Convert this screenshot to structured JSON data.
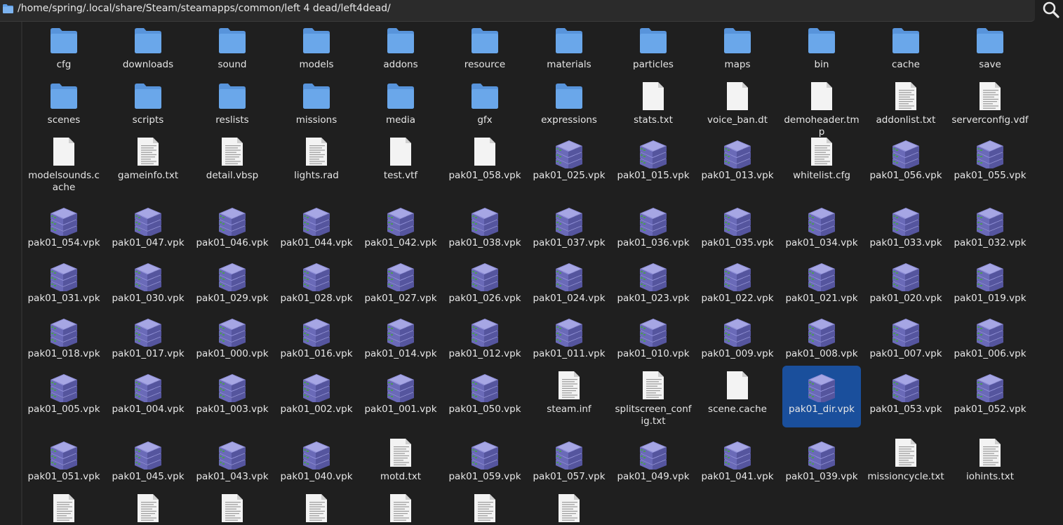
{
  "path_bar": {
    "path": "/home/spring/.local/share/Steam/steamapps/common/left 4 dead/left4dead/"
  },
  "colors": {
    "background": "#1f1f1f",
    "folder": "#6aa7ea",
    "selection": "#1a4f9c",
    "package": "#8f8fd8"
  },
  "files": [
    {
      "name": "cfg",
      "type": "folder"
    },
    {
      "name": "downloads",
      "type": "folder"
    },
    {
      "name": "sound",
      "type": "folder"
    },
    {
      "name": "models",
      "type": "folder"
    },
    {
      "name": "addons",
      "type": "folder"
    },
    {
      "name": "resource",
      "type": "folder"
    },
    {
      "name": "materials",
      "type": "folder"
    },
    {
      "name": "particles",
      "type": "folder"
    },
    {
      "name": "maps",
      "type": "folder"
    },
    {
      "name": "bin",
      "type": "folder"
    },
    {
      "name": "cache",
      "type": "folder"
    },
    {
      "name": "save",
      "type": "folder"
    },
    {
      "name": "scenes",
      "type": "folder"
    },
    {
      "name": "scripts",
      "type": "folder"
    },
    {
      "name": "reslists",
      "type": "folder"
    },
    {
      "name": "missions",
      "type": "folder"
    },
    {
      "name": "media",
      "type": "folder"
    },
    {
      "name": "gfx",
      "type": "folder"
    },
    {
      "name": "expressions",
      "type": "folder"
    },
    {
      "name": "stats.txt",
      "type": "blank"
    },
    {
      "name": "voice_ban.dt",
      "type": "blank"
    },
    {
      "name": "demoheader.tmp",
      "type": "blank"
    },
    {
      "name": "addonlist.txt",
      "type": "text"
    },
    {
      "name": "serverconfig.vdf",
      "type": "text"
    },
    {
      "name": "modelsounds.cache",
      "type": "blank"
    },
    {
      "name": "gameinfo.txt",
      "type": "text"
    },
    {
      "name": "detail.vbsp",
      "type": "text"
    },
    {
      "name": "lights.rad",
      "type": "text"
    },
    {
      "name": "test.vtf",
      "type": "blank"
    },
    {
      "name": "pak01_058.vpk",
      "type": "blank"
    },
    {
      "name": "pak01_025.vpk",
      "type": "package"
    },
    {
      "name": "pak01_015.vpk",
      "type": "package"
    },
    {
      "name": "pak01_013.vpk",
      "type": "package"
    },
    {
      "name": "whitelist.cfg",
      "type": "text"
    },
    {
      "name": "pak01_056.vpk",
      "type": "package"
    },
    {
      "name": "pak01_055.vpk",
      "type": "package"
    },
    {
      "name": "pak01_054.vpk",
      "type": "package"
    },
    {
      "name": "pak01_047.vpk",
      "type": "package"
    },
    {
      "name": "pak01_046.vpk",
      "type": "package"
    },
    {
      "name": "pak01_044.vpk",
      "type": "package"
    },
    {
      "name": "pak01_042.vpk",
      "type": "package"
    },
    {
      "name": "pak01_038.vpk",
      "type": "package"
    },
    {
      "name": "pak01_037.vpk",
      "type": "package"
    },
    {
      "name": "pak01_036.vpk",
      "type": "package"
    },
    {
      "name": "pak01_035.vpk",
      "type": "package"
    },
    {
      "name": "pak01_034.vpk",
      "type": "package"
    },
    {
      "name": "pak01_033.vpk",
      "type": "package"
    },
    {
      "name": "pak01_032.vpk",
      "type": "package"
    },
    {
      "name": "pak01_031.vpk",
      "type": "package"
    },
    {
      "name": "pak01_030.vpk",
      "type": "package"
    },
    {
      "name": "pak01_029.vpk",
      "type": "package"
    },
    {
      "name": "pak01_028.vpk",
      "type": "package"
    },
    {
      "name": "pak01_027.vpk",
      "type": "package"
    },
    {
      "name": "pak01_026.vpk",
      "type": "package"
    },
    {
      "name": "pak01_024.vpk",
      "type": "package"
    },
    {
      "name": "pak01_023.vpk",
      "type": "package"
    },
    {
      "name": "pak01_022.vpk",
      "type": "package"
    },
    {
      "name": "pak01_021.vpk",
      "type": "package"
    },
    {
      "name": "pak01_020.vpk",
      "type": "package"
    },
    {
      "name": "pak01_019.vpk",
      "type": "package"
    },
    {
      "name": "pak01_018.vpk",
      "type": "package"
    },
    {
      "name": "pak01_017.vpk",
      "type": "package"
    },
    {
      "name": "pak01_000.vpk",
      "type": "package"
    },
    {
      "name": "pak01_016.vpk",
      "type": "package"
    },
    {
      "name": "pak01_014.vpk",
      "type": "package"
    },
    {
      "name": "pak01_012.vpk",
      "type": "package"
    },
    {
      "name": "pak01_011.vpk",
      "type": "package"
    },
    {
      "name": "pak01_010.vpk",
      "type": "package"
    },
    {
      "name": "pak01_009.vpk",
      "type": "package"
    },
    {
      "name": "pak01_008.vpk",
      "type": "package"
    },
    {
      "name": "pak01_007.vpk",
      "type": "package"
    },
    {
      "name": "pak01_006.vpk",
      "type": "package"
    },
    {
      "name": "pak01_005.vpk",
      "type": "package"
    },
    {
      "name": "pak01_004.vpk",
      "type": "package"
    },
    {
      "name": "pak01_003.vpk",
      "type": "package"
    },
    {
      "name": "pak01_002.vpk",
      "type": "package"
    },
    {
      "name": "pak01_001.vpk",
      "type": "package"
    },
    {
      "name": "pak01_050.vpk",
      "type": "package"
    },
    {
      "name": "steam.inf",
      "type": "text"
    },
    {
      "name": "splitscreen_config.txt",
      "type": "text"
    },
    {
      "name": "scene.cache",
      "type": "blank"
    },
    {
      "name": "pak01_dir.vpk",
      "type": "package",
      "selected": true
    },
    {
      "name": "pak01_053.vpk",
      "type": "package"
    },
    {
      "name": "pak01_052.vpk",
      "type": "package"
    },
    {
      "name": "pak01_051.vpk",
      "type": "package"
    },
    {
      "name": "pak01_045.vpk",
      "type": "package"
    },
    {
      "name": "pak01_043.vpk",
      "type": "package"
    },
    {
      "name": "pak01_040.vpk",
      "type": "package"
    },
    {
      "name": "motd.txt",
      "type": "text"
    },
    {
      "name": "pak01_059.vpk",
      "type": "package"
    },
    {
      "name": "pak01_057.vpk",
      "type": "package"
    },
    {
      "name": "pak01_049.vpk",
      "type": "package"
    },
    {
      "name": "pak01_041.vpk",
      "type": "package"
    },
    {
      "name": "pak01_039.vpk",
      "type": "package"
    },
    {
      "name": "missioncycle.txt",
      "type": "text"
    },
    {
      "name": "iohints.txt",
      "type": "text"
    },
    {
      "name": "",
      "type": "text"
    },
    {
      "name": "",
      "type": "text"
    },
    {
      "name": "",
      "type": "text"
    },
    {
      "name": "",
      "type": "text"
    },
    {
      "name": "",
      "type": "text"
    },
    {
      "name": "",
      "type": "text"
    },
    {
      "name": "",
      "type": "text"
    }
  ]
}
